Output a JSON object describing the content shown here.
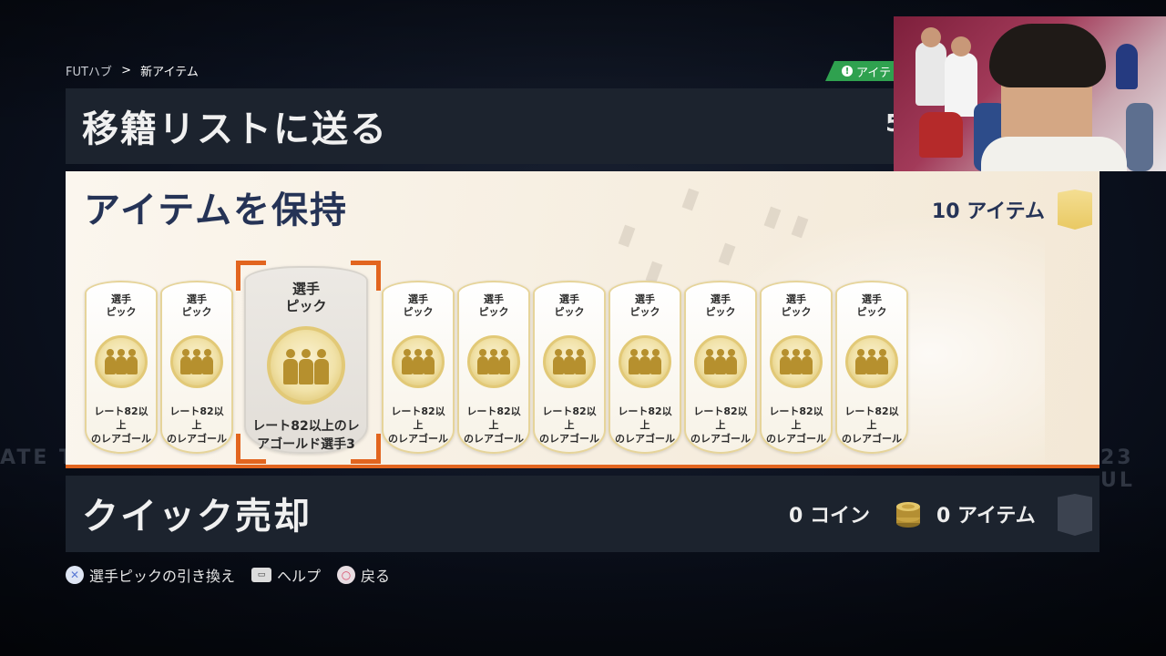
{
  "breadcrumb": {
    "root": "FUTハブ",
    "separator": ">",
    "current": "新アイテム"
  },
  "notice": {
    "text": "アイテ"
  },
  "transfer_panel": {
    "title": "移籍リストに送る",
    "count": "5"
  },
  "keep_panel": {
    "title": "アイテムを保持",
    "count": "10 アイテム",
    "cards": [
      {
        "label": "選手\nピック",
        "sub": "レート82以上\nのレアゴール"
      },
      {
        "label": "選手\nピック",
        "sub": "レート82以上\nのレアゴール"
      },
      {
        "label": "選手\nピック",
        "sub": "レート82以上のレ\nアゴールド選手3",
        "selected": true
      },
      {
        "label": "選手\nピック",
        "sub": "レート82以上\nのレアゴール"
      },
      {
        "label": "選手\nピック",
        "sub": "レート82以上\nのレアゴール"
      },
      {
        "label": "選手\nピック",
        "sub": "レート82以上\nのレアゴール"
      },
      {
        "label": "選手\nピック",
        "sub": "レート82以上\nのレアゴール"
      },
      {
        "label": "選手\nピック",
        "sub": "レート82以上\nのレアゴール"
      },
      {
        "label": "選手\nピック",
        "sub": "レート82以上\nのレアゴール"
      },
      {
        "label": "選手\nピック",
        "sub": "レート82以上\nのレアゴール"
      }
    ]
  },
  "quick_sell_panel": {
    "title": "クイック売却",
    "coins": "0 コイン",
    "items": "0 アイテム"
  },
  "footer": {
    "swap": "選手ピックの引き換え",
    "help": "ヘルプ",
    "back": "戻る"
  },
  "background_text": {
    "left": "ATE T",
    "right": "23 UL"
  },
  "colors": {
    "accent": "#e2651f",
    "panel_dark": "#1c232e",
    "title_navy": "#253356",
    "notice_green": "#2fa14f"
  },
  "icons": [
    "cross-button-icon",
    "touchpad-icon",
    "circle-button-icon",
    "coin-stack-icon",
    "gold-badge-icon",
    "gray-badge-icon",
    "person-group-icon"
  ]
}
